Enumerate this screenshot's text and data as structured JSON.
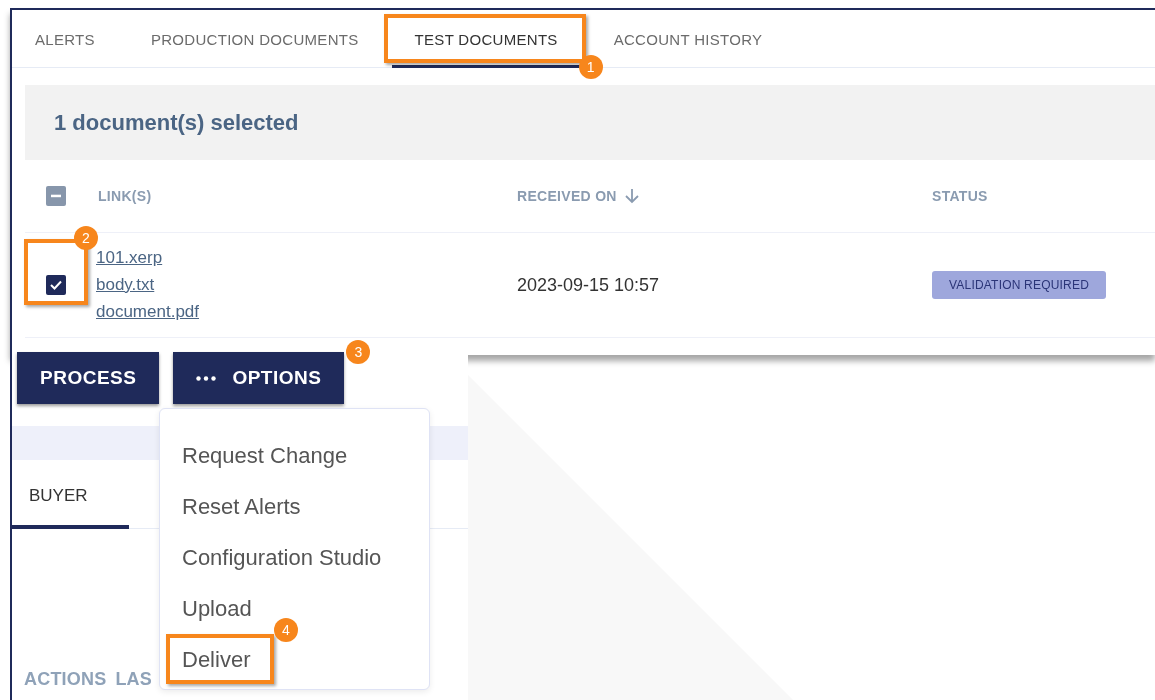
{
  "tabs": [
    {
      "label": "ALERTS",
      "selected": false
    },
    {
      "label": "PRODUCTION DOCUMENTS",
      "selected": false
    },
    {
      "label": "TEST DOCUMENTS",
      "selected": true,
      "callout": {
        "number": "1",
        "boxed": true
      }
    },
    {
      "label": "ACCOUNT HISTORY",
      "selected": false
    }
  ],
  "selection_summary": "1 document(s) selected",
  "table": {
    "select_all": {
      "indeterminate": true
    },
    "columns": [
      {
        "label": "LINK(S)",
        "sorted": false
      },
      {
        "label": "RECEIVED ON",
        "sorted": true
      },
      {
        "label": "STATUS",
        "sorted": false
      }
    ],
    "rows": [
      {
        "checked": true,
        "callout": {
          "number": "2",
          "boxed": true
        },
        "links": [
          "101.xerp",
          "body.txt",
          "document.pdf"
        ],
        "received_on": "2023-09-15 10:57",
        "status": "VALIDATION REQUIRED"
      }
    ]
  },
  "actions": [
    {
      "label": "PROCESS",
      "kind": "plain"
    },
    {
      "label": "OPTIONS",
      "kind": "menu",
      "callout": {
        "number": "3",
        "boxed": false
      }
    }
  ],
  "lower_tabs": [
    {
      "label": "BUYER",
      "selected": true
    }
  ],
  "section_headers": [
    "ACTIONS",
    "LAS"
  ],
  "options_menu": {
    "items": [
      {
        "label": "Request Change"
      },
      {
        "label": "Reset Alerts"
      },
      {
        "label": "Configuration Studio"
      },
      {
        "label": "Upload"
      },
      {
        "label": "Deliver",
        "callout": {
          "number": "4",
          "boxed": true
        }
      }
    ]
  }
}
